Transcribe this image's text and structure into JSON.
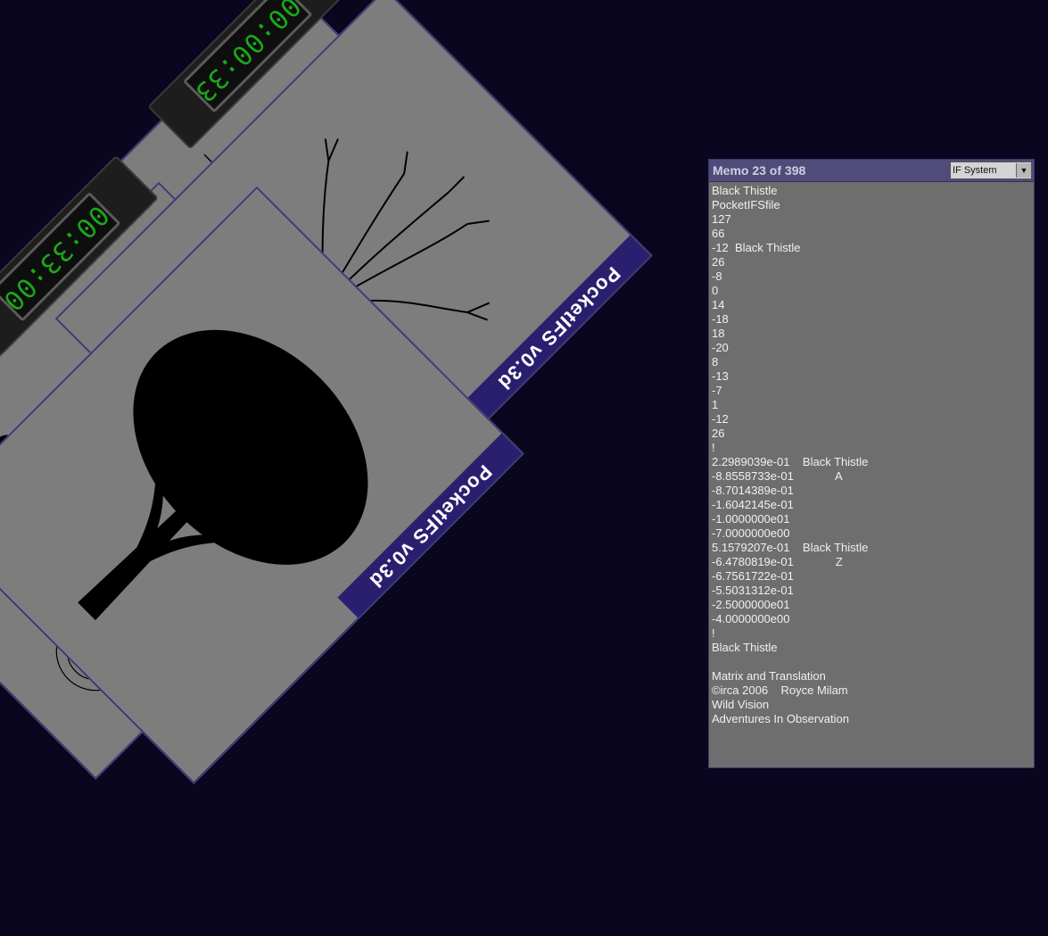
{
  "panes": {
    "band_label": "PocketIFS v0.3d"
  },
  "clocks": [
    "00:00:33",
    "00:33:00"
  ],
  "memo": {
    "title": "Memo 23 of 398",
    "dropdown": "IF System",
    "lines": [
      "Black Thistle",
      "PocketIFSfile",
      "127",
      "66",
      "-12  Black Thistle",
      "26",
      "-8",
      "0",
      "14",
      "-18",
      "18",
      "-20",
      "8",
      "-13",
      "-7",
      "1",
      "-12",
      "26",
      "!",
      "2.2989039e-01    Black Thistle",
      "-8.8558733e-01             A",
      "-8.7014389e-01",
      "-1.6042145e-01",
      "-1.0000000e01",
      "-7.0000000e00",
      "5.1579207e-01    Black Thistle",
      "-6.4780819e-01             Z",
      "-6.7561722e-01",
      "-5.5031312e-01",
      "-2.5000000e01",
      "-4.0000000e00",
      "!",
      "Black Thistle",
      "",
      "Matrix and Translation",
      "©irca 2006    Royce Milam",
      "Wild Vision",
      "Adventures In Observation"
    ]
  }
}
